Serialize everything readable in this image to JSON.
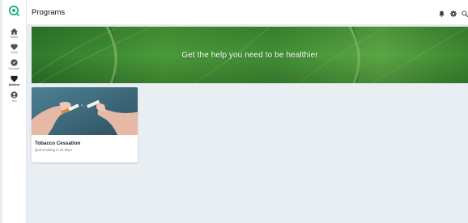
{
  "app": {
    "brand_color": "#20b27a"
  },
  "sidebar": {
    "items": [
      {
        "label": "Home",
        "icon": "home-icon"
      },
      {
        "label": "Track",
        "icon": "heart-icon"
      },
      {
        "label": "Discover",
        "icon": "compass-icon"
      },
      {
        "label": "Achieve",
        "icon": "shield-icon",
        "active": true
      },
      {
        "label": "You",
        "icon": "user-icon"
      }
    ]
  },
  "header": {
    "title": "Programs",
    "icons": [
      "bell-icon",
      "gear-icon",
      "search-icon"
    ]
  },
  "banner": {
    "text": "Get the help you need to be healthier"
  },
  "programs": [
    {
      "title": "Tobacco Cessation",
      "subtitle": "Quit smoking in 21 days"
    }
  ]
}
